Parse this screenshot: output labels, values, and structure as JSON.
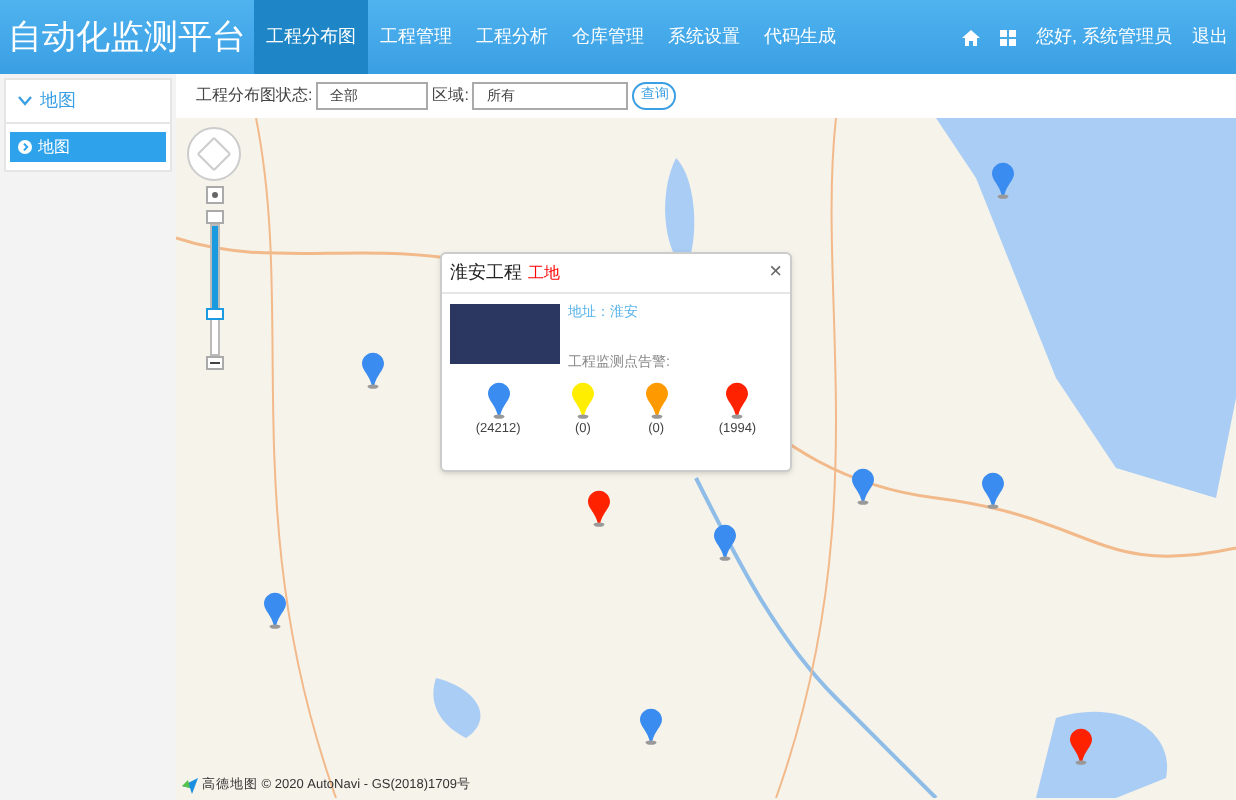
{
  "header": {
    "title": "自动化监测平台",
    "nav": [
      {
        "label": "工程分布图",
        "selected": true
      },
      {
        "label": "工程管理",
        "selected": false
      },
      {
        "label": "工程分析",
        "selected": false
      },
      {
        "label": "仓库管理",
        "selected": false
      },
      {
        "label": "系统设置",
        "selected": false
      },
      {
        "label": "代码生成",
        "selected": false
      }
    ],
    "greeting": "您好, 系统管理员",
    "logout": "退出"
  },
  "sidebar": {
    "section": {
      "label": "地图",
      "expanded": true
    },
    "items": [
      {
        "label": "地图",
        "selected": true
      }
    ]
  },
  "filter": {
    "status_label": "工程分布图状态:",
    "status_value": "全部",
    "area_label": "区域:",
    "area_value": "所有",
    "query": "查询"
  },
  "map": {
    "zoom": {
      "level": 0.68
    },
    "markers": [
      {
        "color": "#3b8cf0"
      },
      {
        "color": "#3b8cf0"
      },
      {
        "color": "#3b8cf0"
      },
      {
        "color": "#3b8cf0"
      },
      {
        "color": "#3b8cf0"
      },
      {
        "color": "#3b8cf0"
      },
      {
        "color": "#3b8cf0"
      },
      {
        "color": "#ff2200"
      },
      {
        "color": "#ff2200"
      }
    ],
    "popup": {
      "title": "淮安工程",
      "tag": "工地",
      "address": "地址：淮安",
      "alarm_label": "工程监测点告警:",
      "close": "×",
      "counts": [
        {
          "color": "#3b8cf0",
          "value": "(24212)"
        },
        {
          "color": "#ffee00",
          "value": "(0)"
        },
        {
          "color": "#ff9900",
          "value": "(0)"
        },
        {
          "color": "#ff2200",
          "value": "(1994)"
        }
      ]
    },
    "attribution": "高德地图 © 2020 AutoNavi  - GS(2018)1709号"
  }
}
